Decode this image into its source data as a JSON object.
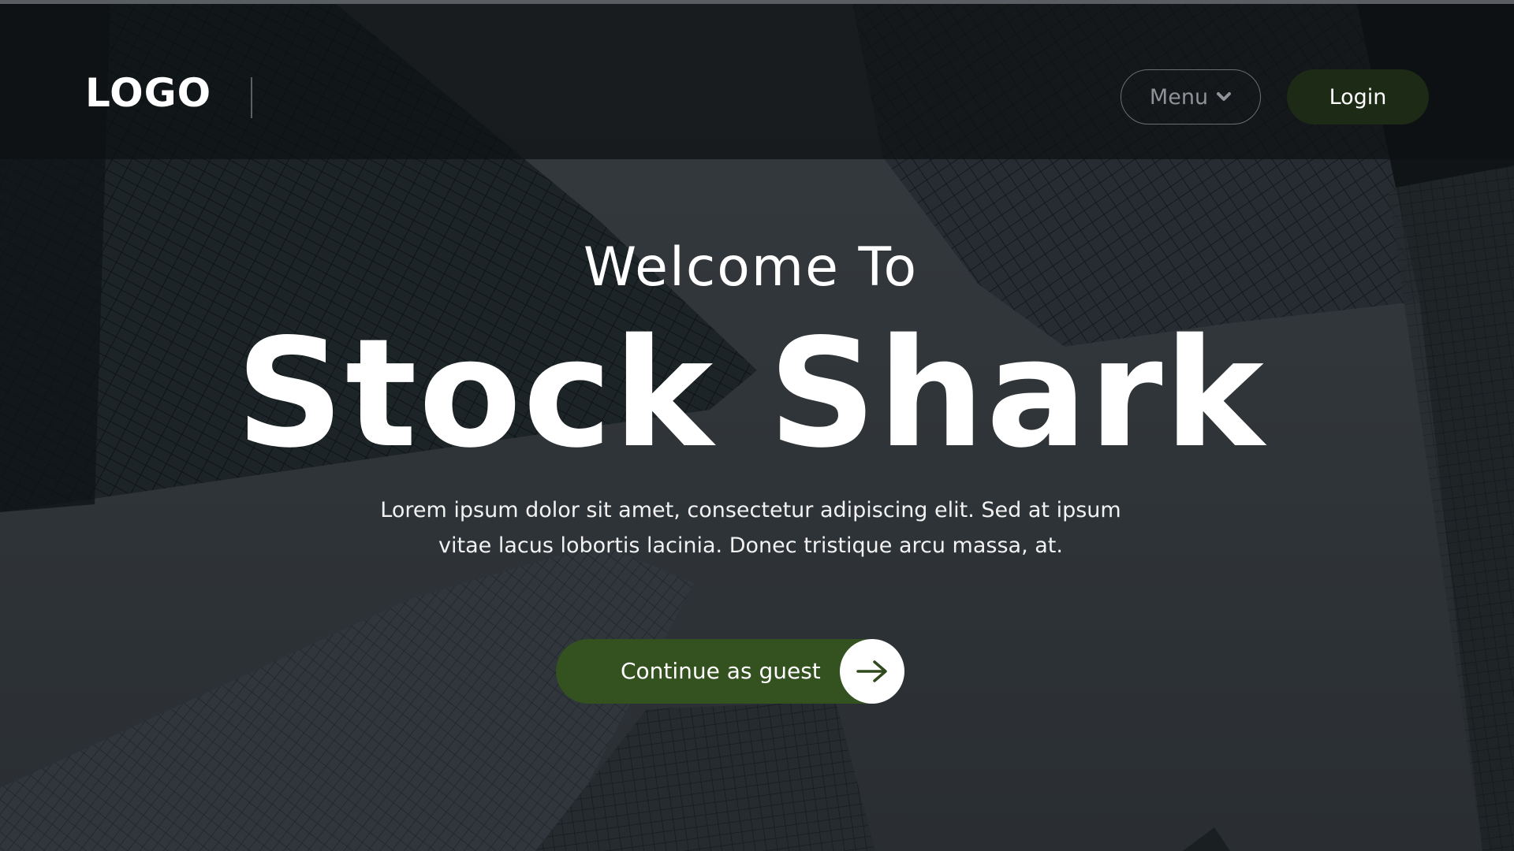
{
  "header": {
    "logo_text": "LOGO",
    "menu_label": "Menu",
    "menu_icon": "chevron-down-icon",
    "login_label": "Login"
  },
  "hero": {
    "welcome": "Welcome To",
    "title": "Stock Shark",
    "description_line1": "Lorem ipsum dolor sit amet, consectetur adipiscing elit. Sed at ipsum",
    "description_line2": "vitae lacus lobortis lacinia. Donec tristique arcu massa, at.",
    "cta_label": "Continue as guest",
    "cta_icon": "arrow-right-icon"
  },
  "colors": {
    "accent_green": "#33521f",
    "login_green": "#1c2a16",
    "header_bg": "#0e1012",
    "text": "#ffffff"
  }
}
